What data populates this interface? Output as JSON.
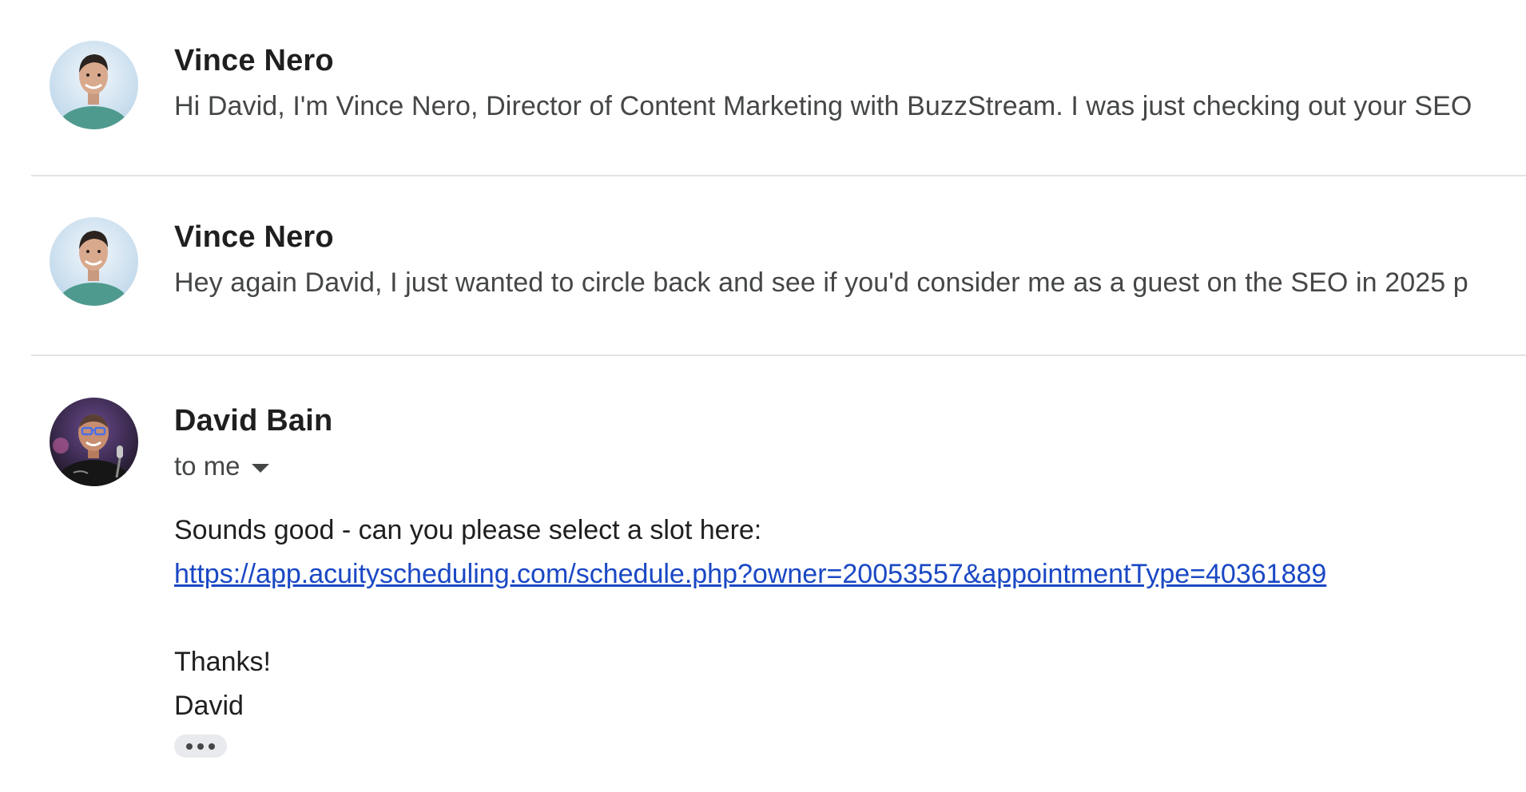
{
  "thread": {
    "messages": [
      {
        "sender": "Vince Nero",
        "snippet": "Hi David, I'm Vince Nero, Director of Content Marketing with BuzzStream. I was just checking out your SEO",
        "avatar_icon": "person-avatar-icon"
      },
      {
        "sender": "Vince Nero",
        "snippet": "Hey again David, I just wanted to circle back and see if you'd consider me as a guest on the SEO in 2025 p",
        "avatar_icon": "person-avatar-icon"
      }
    ],
    "expanded": {
      "sender": "David Bain",
      "recipient": "to me",
      "body_line_1": "Sounds good - can you please select a slot here:",
      "link": "https://app.acuityscheduling.com/schedule.php?owner=20053557&appointmentType=40361889",
      "closing": "Thanks!",
      "signature": "David",
      "avatar_icon": "person-avatar-icon",
      "more_icon": "ellipsis-icon"
    }
  },
  "colors": {
    "link": "#1a48c4",
    "divider": "#e3e3e3",
    "snippet_text": "#444746",
    "chip_bg": "#e8eaed"
  }
}
